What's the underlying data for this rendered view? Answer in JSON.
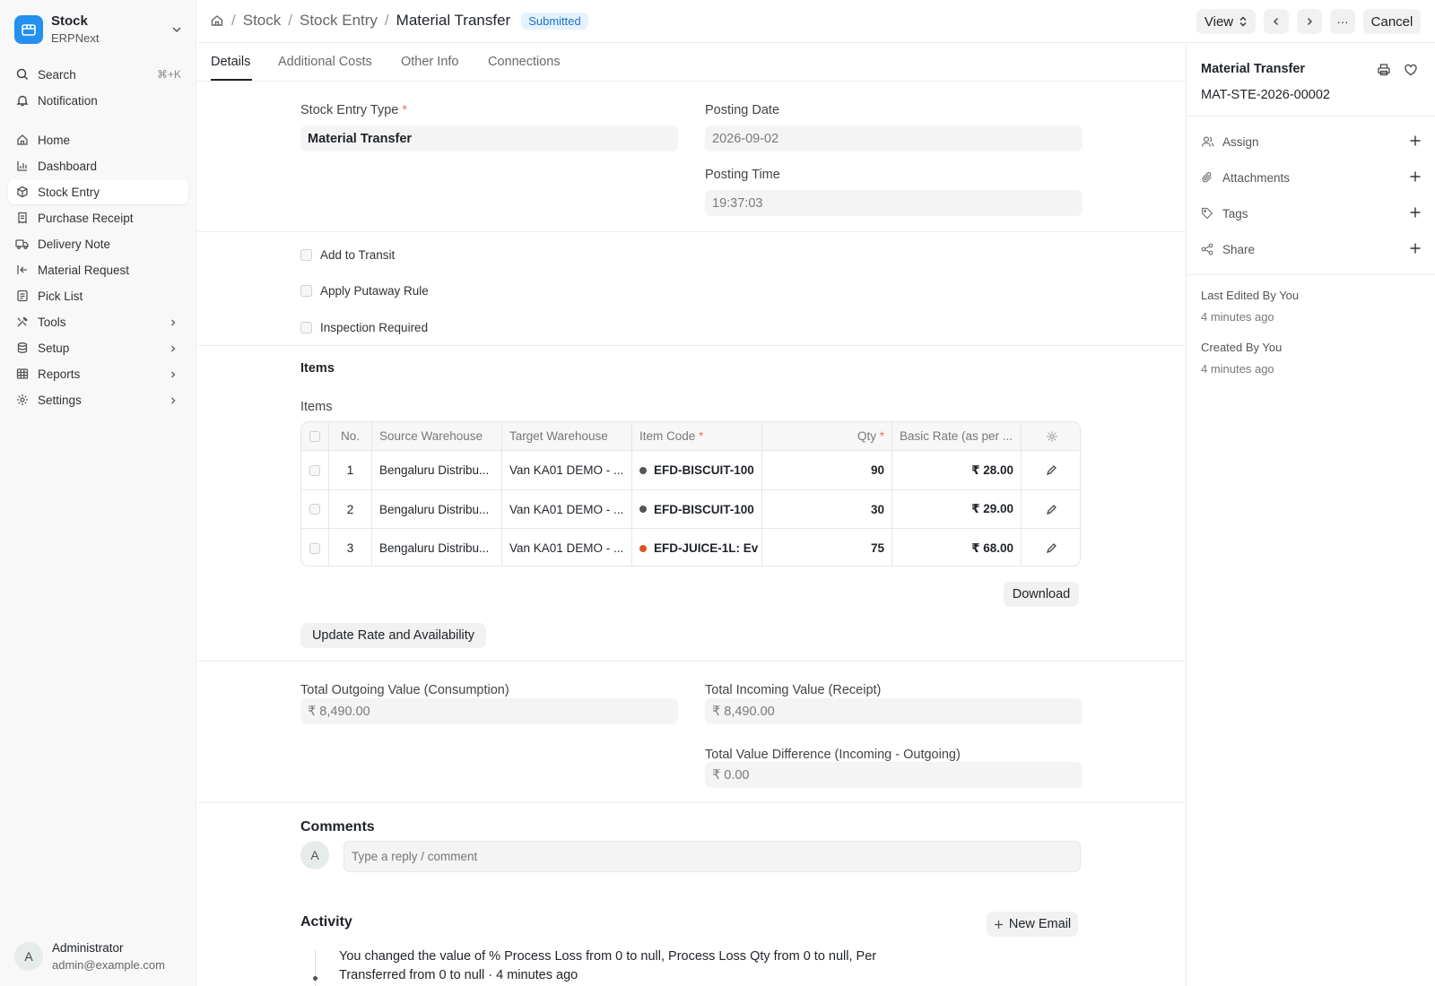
{
  "app": {
    "name": "Stock",
    "sub": "ERPNext"
  },
  "sidebar": {
    "search": {
      "label": "Search",
      "shortcut": "⌘+K"
    },
    "notification": "Notification",
    "items": [
      {
        "label": "Home",
        "icon": "home-icon"
      },
      {
        "label": "Dashboard",
        "icon": "chart-icon"
      },
      {
        "label": "Stock Entry",
        "icon": "box-icon",
        "active": true
      },
      {
        "label": "Purchase Receipt",
        "icon": "receipt-icon"
      },
      {
        "label": "Delivery Note",
        "icon": "truck-icon"
      },
      {
        "label": "Material Request",
        "icon": "arrow-left-bar-icon"
      },
      {
        "label": "Pick List",
        "icon": "list-icon"
      },
      {
        "label": "Tools",
        "icon": "tools-icon",
        "expandable": true
      },
      {
        "label": "Setup",
        "icon": "database-icon",
        "expandable": true
      },
      {
        "label": "Reports",
        "icon": "table-icon",
        "expandable": true
      },
      {
        "label": "Settings",
        "icon": "gear-icon",
        "expandable": true
      }
    ],
    "user": {
      "initial": "A",
      "name": "Administrator",
      "email": "admin@example.com"
    }
  },
  "header": {
    "breadcrumbs": [
      "Stock",
      "Stock Entry"
    ],
    "title": "Material Transfer",
    "status": "Submitted",
    "view_label": "View",
    "more_label": "···",
    "cancel_label": "Cancel"
  },
  "tabs": [
    "Details",
    "Additional Costs",
    "Other Info",
    "Connections"
  ],
  "form": {
    "stock_entry_type": {
      "label": "Stock Entry Type",
      "value": "Material Transfer"
    },
    "posting_date": {
      "label": "Posting Date",
      "value": "2026-09-02"
    },
    "posting_time": {
      "label": "Posting Time",
      "value": "19:37:03"
    },
    "checks": [
      "Add to Transit",
      "Apply Putaway Rule",
      "Inspection Required"
    ],
    "items_section": "Items",
    "items_label": "Items",
    "update_button": "Update Rate and Availability",
    "download_button": "Download",
    "total_outgoing": {
      "label": "Total Outgoing Value (Consumption)",
      "value": "₹ 8,490.00"
    },
    "total_incoming": {
      "label": "Total Incoming Value (Receipt)",
      "value": "₹ 8,490.00"
    },
    "value_difference": {
      "label": "Total Value Difference (Incoming - Outgoing)",
      "value": "₹ 0.00"
    }
  },
  "table": {
    "headers": {
      "no": "No.",
      "source": "Source Warehouse",
      "target": "Target Warehouse",
      "item": "Item Code",
      "qty": "Qty",
      "rate": "Basic Rate (as per ..."
    },
    "rows": [
      {
        "no": "1",
        "source": "Bengaluru Distribu...",
        "target": "Van KA01 DEMO - ...",
        "item": "EFD-BISCUIT-100",
        "dot": "#555555",
        "qty": "90",
        "rate": "₹ 28.00"
      },
      {
        "no": "2",
        "source": "Bengaluru Distribu...",
        "target": "Van KA01 DEMO - ...",
        "item": "EFD-BISCUIT-100",
        "dot": "#555555",
        "qty": "30",
        "rate": "₹ 29.00"
      },
      {
        "no": "3",
        "source": "Bengaluru Distribu...",
        "target": "Van KA01 DEMO - ...",
        "item": "EFD-JUICE-1L: Ev",
        "dot": "#e0531f",
        "qty": "75",
        "rate": "₹ 68.00"
      }
    ]
  },
  "comments": {
    "title": "Comments",
    "avatar": "A",
    "placeholder": "Type a reply / comment"
  },
  "activity": {
    "title": "Activity",
    "new_email": "New Email",
    "entry": "You changed the value of % Process Loss from 0 to null, Process Loss Qty from 0 to null, Per Transferred from 0 to null · 4 minutes ago"
  },
  "right_panel": {
    "title": "Material Transfer",
    "doc_id": "MAT-STE-2026-00002",
    "actions": [
      "Assign",
      "Attachments",
      "Tags",
      "Share"
    ],
    "last_edited": "Last Edited By You",
    "last_edited_time": "4 minutes ago",
    "created": "Created By You",
    "created_time": "4 minutes ago"
  }
}
